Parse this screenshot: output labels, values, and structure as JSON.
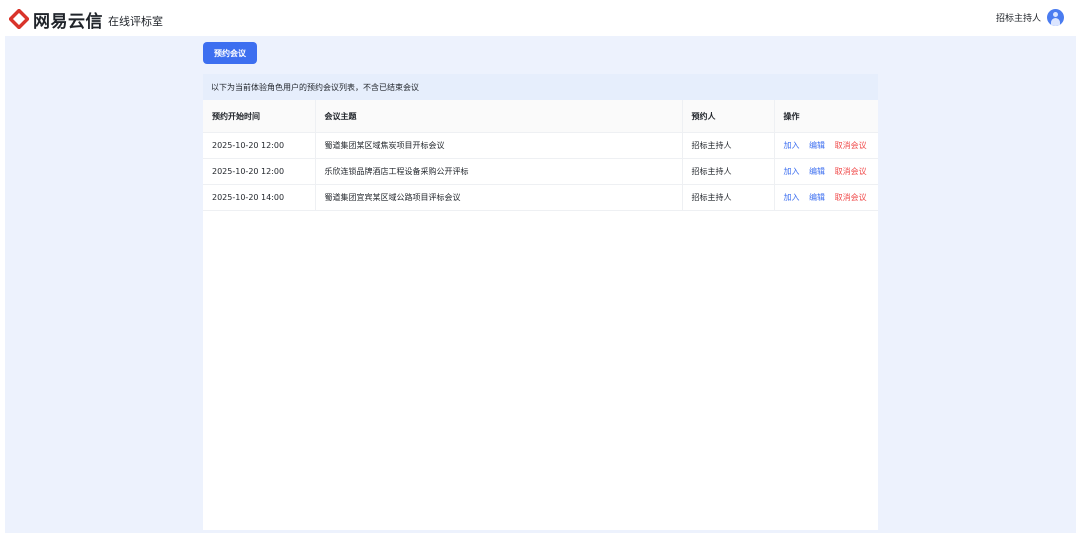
{
  "brand": {
    "name": "网易云信",
    "subtitle": "在线评标室"
  },
  "user": {
    "name": "招标主持人"
  },
  "toolbar": {
    "book_label": "预约会议"
  },
  "notice": "以下为当前体验角色用户的预约会议列表，不含已结束会议",
  "table": {
    "headers": [
      "预约开始时间",
      "会议主题",
      "预约人",
      "操作"
    ],
    "rows": [
      {
        "time": "2025-10-20 12:00",
        "topic": "蜀道集团某区域焦炭项目开标会议",
        "booker": "招标主持人",
        "join": "加入",
        "edit": "编辑",
        "cancel": "取消会议"
      },
      {
        "time": "2025-10-20 12:00",
        "topic": "乐欣连锁品牌酒店工程设备采购公开评标",
        "booker": "招标主持人",
        "join": "加入",
        "edit": "编辑",
        "cancel": "取消会议"
      },
      {
        "time": "2025-10-20 14:00",
        "topic": "蜀道集团宜宾某区域公路项目评标会议",
        "booker": "招标主持人",
        "join": "加入",
        "edit": "编辑",
        "cancel": "取消会议"
      }
    ]
  },
  "colors": {
    "accent": "#3d6ff0",
    "danger": "#f04b4b",
    "logo": "#d9342b",
    "page_bg": "#edf2fd"
  },
  "icons": {
    "logo": "netease-yunxin-logo-icon",
    "avatar": "user-avatar-icon"
  }
}
